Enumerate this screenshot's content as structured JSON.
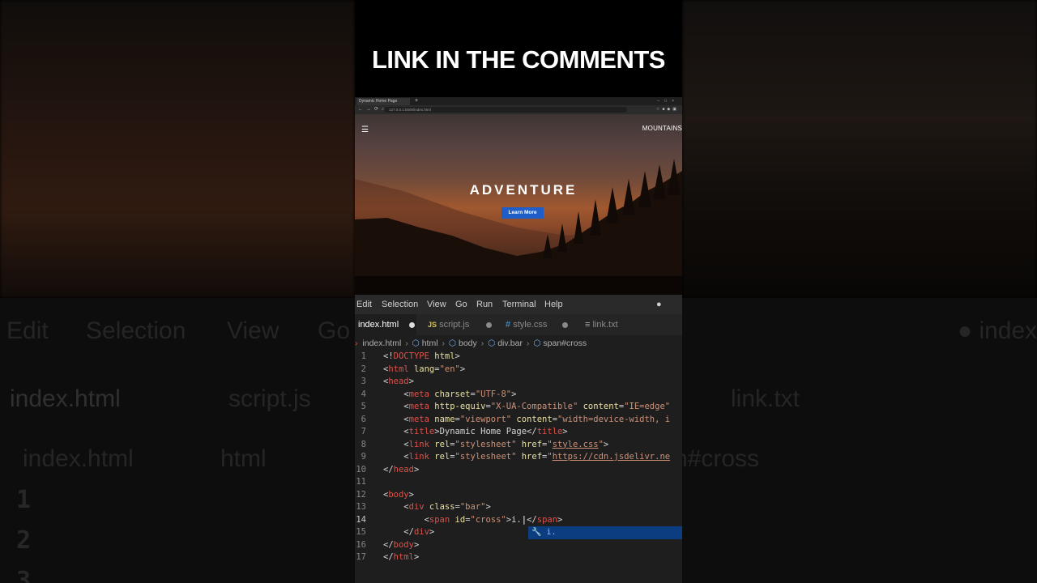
{
  "caption": "LINK IN THE COMMENTS",
  "browser": {
    "tab_title": "Dynamic Home Page",
    "new_tab": "+",
    "url": "127.0.0.1:5500/index.html",
    "brand": "MOUNTAINS",
    "hero_title": "ADVENTURE",
    "hero_button": "Learn More"
  },
  "editor": {
    "menu": [
      "Edit",
      "Selection",
      "View",
      "Go",
      "Run",
      "Terminal",
      "Help"
    ],
    "window_title": "● index",
    "tabs": [
      {
        "icon": "",
        "label": "index.html"
      },
      {
        "icon": "JS",
        "label": "script.js"
      },
      {
        "icon": "#",
        "label": "style.css"
      },
      {
        "icon": "≡",
        "label": "link.txt"
      }
    ],
    "breadcrumb": [
      "index.html",
      "html",
      "body",
      "div.bar",
      "span#cross"
    ],
    "suggestion": "i."
  },
  "background": {
    "left_menu": [
      "Edit",
      "Selection",
      "View",
      "Go"
    ],
    "left_tab": "index.html",
    "left_tab2": "script.js",
    "left_bread_file": "index.html",
    "left_bread_html": "html",
    "left_line1_num": "1",
    "left_line2_num": "2",
    "left_line3_num": "3",
    "right_title": "● index",
    "right_tab": "link.txt",
    "right_bread": "n#cross"
  },
  "accent_colors": {
    "tag": "#e0504a",
    "attr": "#e8e0a0",
    "string": "#ce9178",
    "button": "#1f5ec8"
  }
}
